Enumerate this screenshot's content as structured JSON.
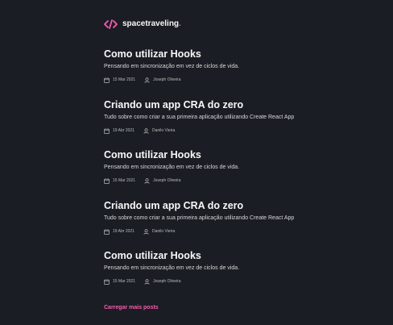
{
  "header": {
    "logo_icon": "code-brackets-icon",
    "brand_name": "spacetraveling",
    "brand_dot": ".",
    "accent_color": "#ff57b2"
  },
  "posts": [
    {
      "title": "Como utilizar Hooks",
      "subtitle": "Pensando em sincronização em vez de ciclos de vida.",
      "date": "15 Mar 2021",
      "author": "Joseph Oliveira"
    },
    {
      "title": "Criando um app CRA do zero",
      "subtitle": "Tudo sobre como criar a sua primeira aplicação utilizando Create React App",
      "date": "19 Abr 2021",
      "author": "Danilo Vieira"
    },
    {
      "title": "Como utilizar Hooks",
      "subtitle": "Pensando em sincronização em vez de ciclos de vida.",
      "date": "15 Mar 2021",
      "author": "Joseph Oliveira"
    },
    {
      "title": "Criando um app CRA do zero",
      "subtitle": "Tudo sobre como criar a sua primeira aplicação utilizando Create React App",
      "date": "19 Abr 2021",
      "author": "Danilo Vieira"
    },
    {
      "title": "Como utilizar Hooks",
      "subtitle": "Pensando em sincronização em vez de ciclos de vida.",
      "date": "15 Mar 2021",
      "author": "Joseph Oliveira"
    }
  ],
  "load_more": {
    "label": "Carregar mais posts"
  }
}
